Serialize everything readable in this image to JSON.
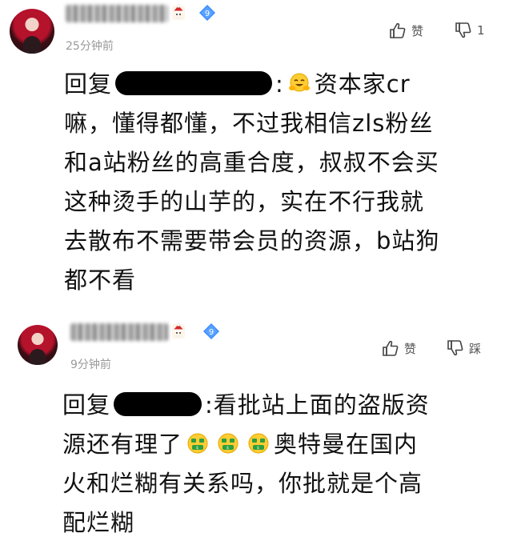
{
  "comments": [
    {
      "timestamp": "25分钟前",
      "level": "9",
      "like_label": "赞",
      "dislike_count": "1",
      "reply_prefix": "回复",
      "reply_lines": [
        ":",
        "资本家cr",
        "嘛，懂得都懂，不过我相信zls粉丝",
        "和a站粉丝的高重合度，叔叔不会买",
        "这种烫手的山芋的，实在不行我就",
        "去散布不需要带会员的资源，b站狗",
        "都不看"
      ]
    },
    {
      "timestamp": "9分钟前",
      "level": "9",
      "like_label": "赞",
      "dislike_label": "踩",
      "reply_prefix": "回复",
      "reply_lines": [
        ":看批站上面的盗版资",
        "源还有理了",
        "奥特曼在国内",
        "火和烂糊有关系吗，你批就是个高",
        "配烂糊"
      ]
    }
  ],
  "icons": {
    "like": "thumbs-up-icon",
    "dislike": "thumbs-down-icon",
    "level_badge": "level-diamond-icon",
    "santa": "santa-hat-icon",
    "emoji_hug": "hugging-face-emoji",
    "emoji_money": "money-mouth-emoji"
  },
  "colors": {
    "text": "#111111",
    "meta": "#999999",
    "badge": "#3a8bff",
    "redact": "#000000"
  }
}
